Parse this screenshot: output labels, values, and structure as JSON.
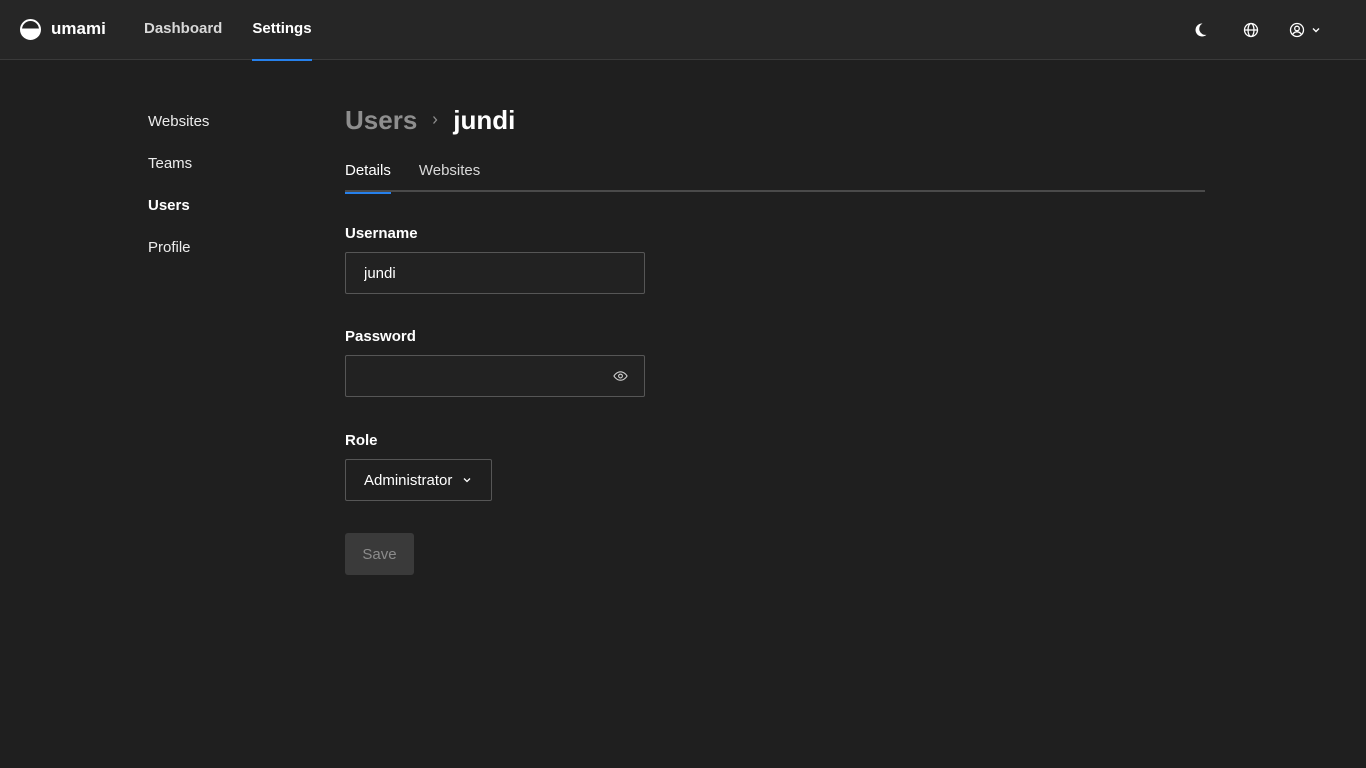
{
  "app": {
    "name": "umami"
  },
  "nav": {
    "items": [
      {
        "label": "Dashboard"
      },
      {
        "label": "Settings"
      }
    ]
  },
  "top_actions": {
    "icons": [
      "moon-icon",
      "globe-icon",
      "user-circle-icon",
      "chevron-down-icon"
    ]
  },
  "sidebar": {
    "items": [
      {
        "label": "Websites"
      },
      {
        "label": "Teams"
      },
      {
        "label": "Users"
      },
      {
        "label": "Profile"
      }
    ],
    "active": "Users"
  },
  "breadcrumb": {
    "parent": "Users",
    "current": "jundi"
  },
  "tabs": [
    {
      "label": "Details"
    },
    {
      "label": "Websites"
    }
  ],
  "form": {
    "username_label": "Username",
    "username_value": "jundi",
    "password_label": "Password",
    "password_value": "",
    "role_label": "Role",
    "role_value": "Administrator",
    "save_label": "Save"
  },
  "colors": {
    "accent": "#2680eb",
    "background": "#1f1f1f",
    "topbar": "#262626"
  }
}
